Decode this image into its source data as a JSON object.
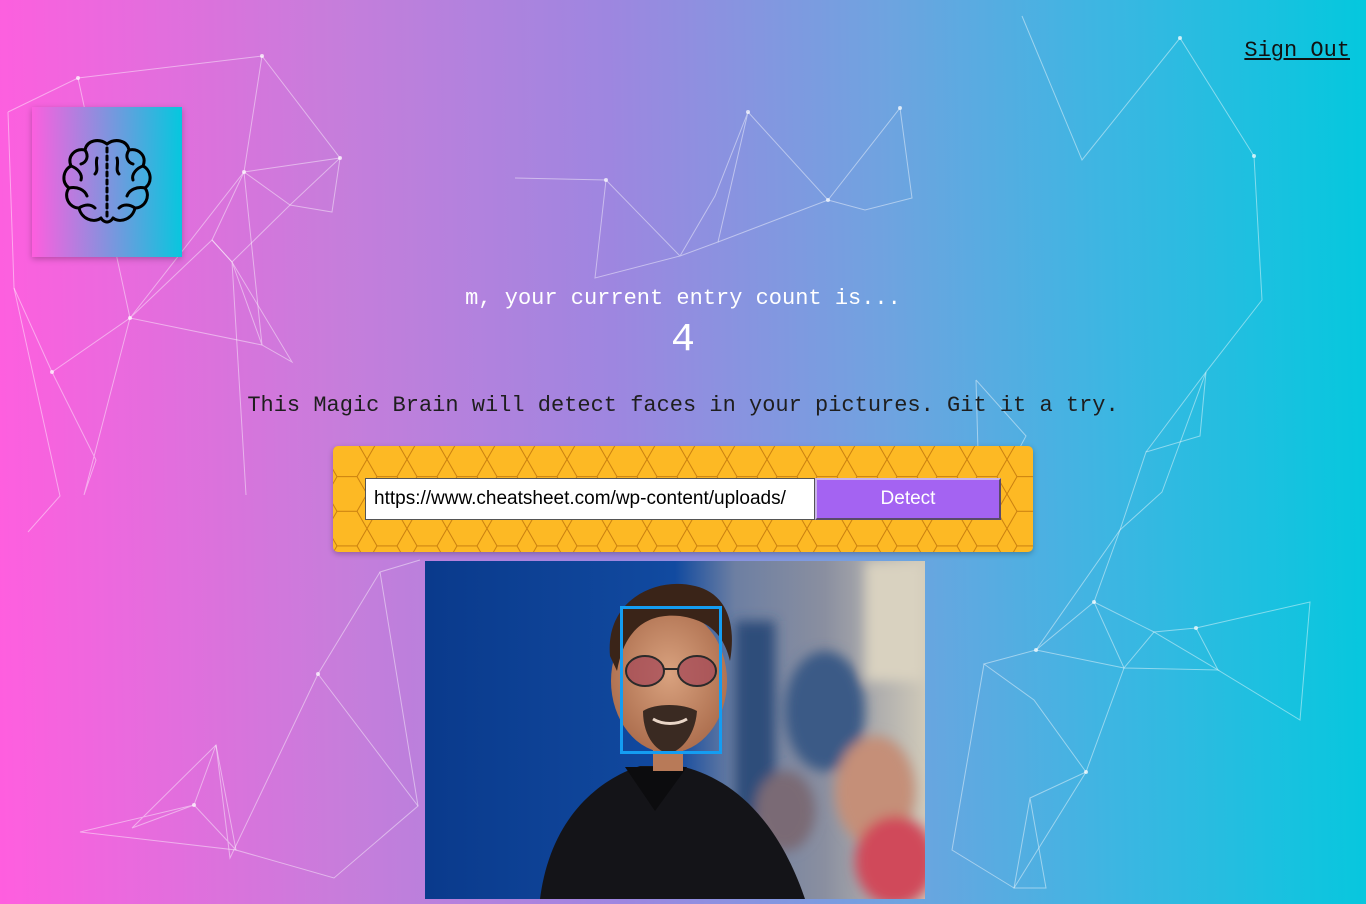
{
  "nav": {
    "sign_out_label": "Sign Out"
  },
  "logo": {
    "icon": "brain-icon"
  },
  "rank": {
    "message": "m, your current entry count is...",
    "count": "4"
  },
  "intro": {
    "text": "This Magic Brain will detect faces in your pictures. Git it a try."
  },
  "form": {
    "url_value": "https://www.cheatsheet.com/wp-content/uploads/",
    "detect_label": "Detect"
  },
  "image": {
    "description_icon": "portrait-photo",
    "face_boxes": 1
  },
  "colors": {
    "gradient_start": "#ff5edf",
    "gradient_end": "#04c8de",
    "form_panel": "#fdb924",
    "detect_button": "#a463f2",
    "face_box": "#149df2"
  }
}
